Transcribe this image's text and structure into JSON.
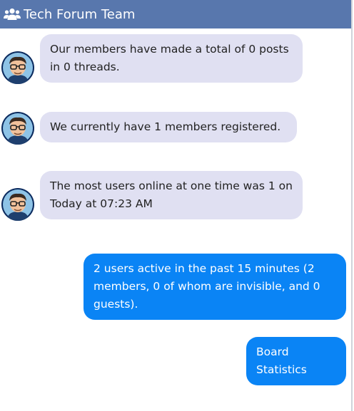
{
  "header": {
    "title": "Tech Forum Team",
    "icon": "users-icon"
  },
  "messages": [
    {
      "side": "incoming",
      "text": "Our members have made a total of 0 posts in 0 threads.",
      "avatar": "cartoon-avatar"
    },
    {
      "side": "incoming",
      "text": "We currently have 1 members registered.",
      "avatar": "cartoon-avatar"
    },
    {
      "side": "incoming",
      "text": "The most users online at one time was 1 on Today at 07:23 AM",
      "avatar": "cartoon-avatar"
    },
    {
      "side": "outgoing",
      "text": "2 users active in the past 15 minutes (2 members, 0 of whom are invisible, and 0 guests)."
    },
    {
      "side": "outgoing",
      "text": "Board Statistics"
    }
  ],
  "colors": {
    "header_bg": "#5877ad",
    "incoming_bubble": "#e0e0f2",
    "outgoing_bubble": "#0a84f5"
  }
}
